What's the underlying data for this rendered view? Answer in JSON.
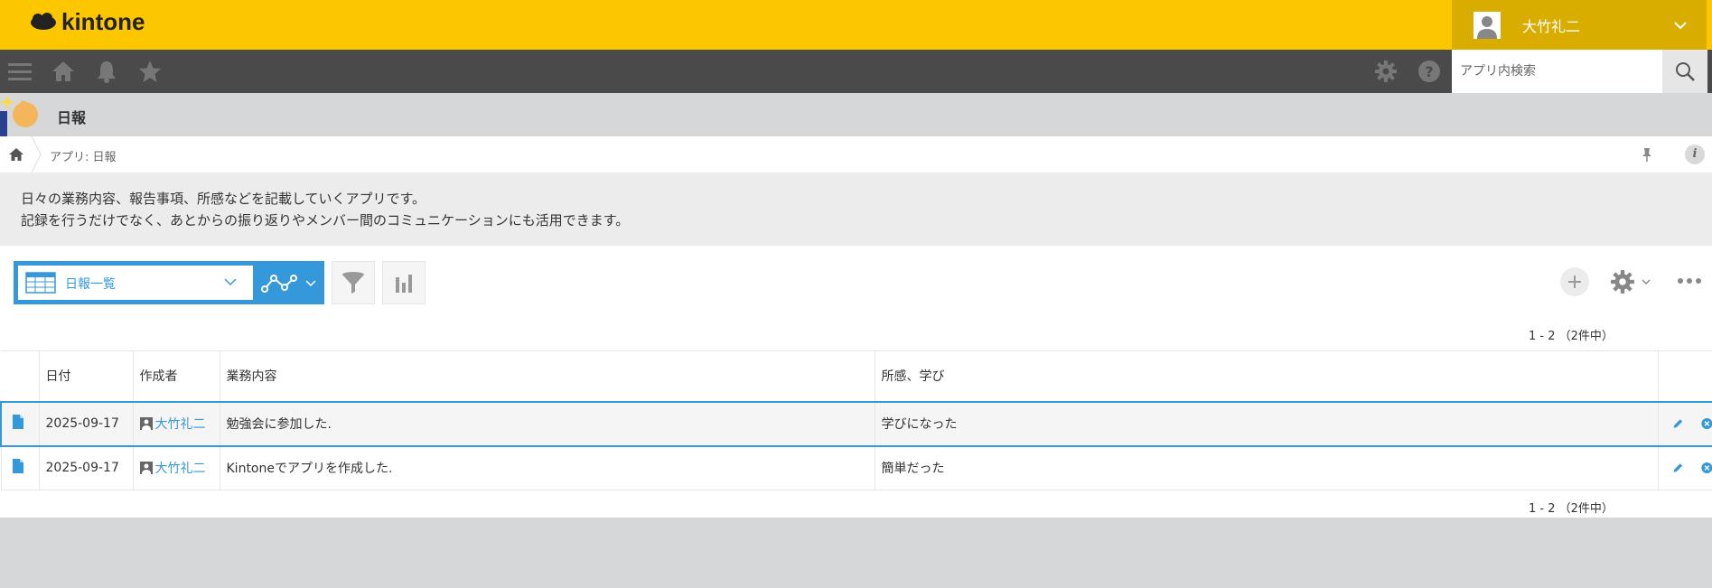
{
  "header": {
    "logo_text": "kintone",
    "user_name": "大竹礼二"
  },
  "navbar": {
    "search_placeholder": "アプリ内検索"
  },
  "app": {
    "title": "日報"
  },
  "breadcrumb": {
    "text": "アプリ: 日報"
  },
  "description": {
    "line1": "日々の業務内容、報告事項、所感などを記載していくアプリです。",
    "line2": "記録を行うだけでなく、あとからの振り返りやメンバー間のコミュニケーションにも活用できます。"
  },
  "toolbar": {
    "view_name": "日報一覧",
    "pager": "1 - 2 （2件中）"
  },
  "table": {
    "headers": [
      "日付",
      "作成者",
      "業務内容",
      "所感、学び"
    ],
    "rows": [
      {
        "date": "2025-09-17",
        "author": "大竹礼二",
        "task": "勉強会に参加した.",
        "reflection": "学びになった"
      },
      {
        "date": "2025-09-17",
        "author": "大竹礼二",
        "task": "Kintoneでアプリを作成した.",
        "reflection": "簡単だった"
      }
    ]
  },
  "colors": {
    "header_yellow": "#fdc700",
    "user_area": "#d9ad00",
    "navbar": "#4a4a4a",
    "accent_blue": "#3498db"
  },
  "icons": [
    "hamburger-icon",
    "home-icon",
    "bell-icon",
    "star-icon",
    "gear-icon",
    "help-icon",
    "search-icon",
    "pin-icon",
    "info-icon",
    "table-view-icon",
    "graph-icon",
    "filter-icon",
    "bar-chart-icon",
    "plus-icon",
    "more-icon",
    "record-icon",
    "edit-icon",
    "delete-icon"
  ]
}
